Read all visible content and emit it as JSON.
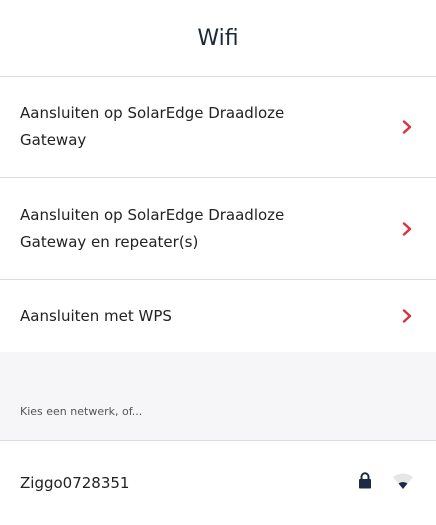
{
  "header": {
    "title": "Wifi"
  },
  "options": [
    {
      "label": "Aansluiten op SolarEdge Draadloze Gateway"
    },
    {
      "label": "Aansluiten op SolarEdge Draadloze Gateway en repeater(s)"
    },
    {
      "label": "Aansluiten met WPS"
    }
  ],
  "networks_section": {
    "hint": "Kies een netwerk, of..."
  },
  "networks": [
    {
      "ssid": "Ziggo0728351",
      "secured": true,
      "icons": [
        "lock-icon",
        "wifi-signal-icon"
      ]
    }
  ],
  "colors": {
    "accent": "#e0313a",
    "title": "#1a2a3a",
    "section_bg": "#f6f5f8",
    "lock": "#1c2b44"
  }
}
